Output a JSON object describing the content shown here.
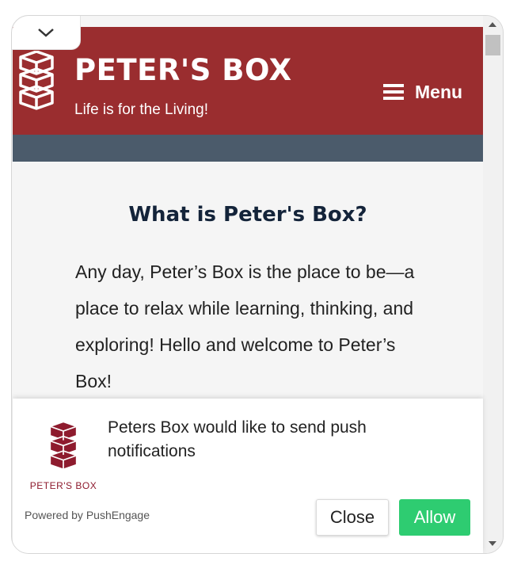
{
  "header": {
    "site_title": "PETER'S BOX",
    "tagline": "Life is for the Living!",
    "menu_label": "Menu"
  },
  "main": {
    "heading": "What is Peter's Box?",
    "paragraph": "Any day, Peter’s Box is the place to be—a place to relax while learning, thinking, and exploring! Hello and welcome to Peter’s Box!"
  },
  "push_prompt": {
    "brand": "PETER'S BOX",
    "message": "Peters Box would like to send push notifications",
    "powered_by": "Powered by PushEngage",
    "close_label": "Close",
    "allow_label": "Allow"
  },
  "colors": {
    "header_bg": "#9a2d2f",
    "subnav_bg": "#4b5b6b",
    "allow_bg": "#2ecc71",
    "brand_red": "#8e1b2e"
  },
  "icons": {
    "collapse": "chevron-down-icon",
    "menu": "hamburger-icon",
    "logo": "stacked-boxes-logo"
  }
}
